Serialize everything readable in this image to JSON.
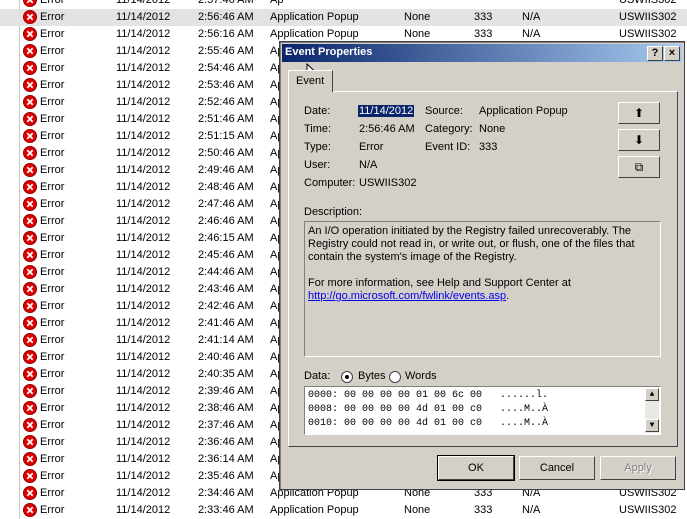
{
  "list": {
    "rows": [
      {
        "type": "Error",
        "date": "11/14/2012",
        "time": "2:57:46 AM",
        "source": "Ap",
        "category": "",
        "event": "",
        "user": "",
        "computer": "USWIIS302"
      },
      {
        "type": "Error",
        "date": "11/14/2012",
        "time": "2:56:46 AM",
        "source": "Application Popup",
        "category": "None",
        "event": "333",
        "user": "N/A",
        "computer": "USWIIS302"
      },
      {
        "type": "Error",
        "date": "11/14/2012",
        "time": "2:56:16 AM",
        "source": "Application Popup",
        "category": "None",
        "event": "333",
        "user": "N/A",
        "computer": "USWIIS302"
      },
      {
        "type": "Error",
        "date": "11/14/2012",
        "time": "2:55:46 AM",
        "source": "Ap",
        "category": "",
        "event": "",
        "user": "",
        "computer": ""
      },
      {
        "type": "Error",
        "date": "11/14/2012",
        "time": "2:54:46 AM",
        "source": "Ap",
        "category": "",
        "event": "",
        "user": "",
        "computer": ""
      },
      {
        "type": "Error",
        "date": "11/14/2012",
        "time": "2:53:46 AM",
        "source": "Ap",
        "category": "",
        "event": "",
        "user": "",
        "computer": ""
      },
      {
        "type": "Error",
        "date": "11/14/2012",
        "time": "2:52:46 AM",
        "source": "Ap",
        "category": "",
        "event": "",
        "user": "",
        "computer": ""
      },
      {
        "type": "Error",
        "date": "11/14/2012",
        "time": "2:51:46 AM",
        "source": "Ap",
        "category": "",
        "event": "",
        "user": "",
        "computer": ""
      },
      {
        "type": "Error",
        "date": "11/14/2012",
        "time": "2:51:15 AM",
        "source": "Ap",
        "category": "",
        "event": "",
        "user": "",
        "computer": ""
      },
      {
        "type": "Error",
        "date": "11/14/2012",
        "time": "2:50:46 AM",
        "source": "Ap",
        "category": "",
        "event": "",
        "user": "",
        "computer": ""
      },
      {
        "type": "Error",
        "date": "11/14/2012",
        "time": "2:49:46 AM",
        "source": "Ap",
        "category": "",
        "event": "",
        "user": "",
        "computer": ""
      },
      {
        "type": "Error",
        "date": "11/14/2012",
        "time": "2:48:46 AM",
        "source": "Ap",
        "category": "",
        "event": "",
        "user": "",
        "computer": ""
      },
      {
        "type": "Error",
        "date": "11/14/2012",
        "time": "2:47:46 AM",
        "source": "Ap",
        "category": "",
        "event": "",
        "user": "",
        "computer": ""
      },
      {
        "type": "Error",
        "date": "11/14/2012",
        "time": "2:46:46 AM",
        "source": "Ap",
        "category": "",
        "event": "",
        "user": "",
        "computer": ""
      },
      {
        "type": "Error",
        "date": "11/14/2012",
        "time": "2:46:15 AM",
        "source": "Ap",
        "category": "",
        "event": "",
        "user": "",
        "computer": ""
      },
      {
        "type": "Error",
        "date": "11/14/2012",
        "time": "2:45:46 AM",
        "source": "Ap",
        "category": "",
        "event": "",
        "user": "",
        "computer": ""
      },
      {
        "type": "Error",
        "date": "11/14/2012",
        "time": "2:44:46 AM",
        "source": "Ap",
        "category": "",
        "event": "",
        "user": "",
        "computer": ""
      },
      {
        "type": "Error",
        "date": "11/14/2012",
        "time": "2:43:46 AM",
        "source": "Ap",
        "category": "",
        "event": "",
        "user": "",
        "computer": ""
      },
      {
        "type": "Error",
        "date": "11/14/2012",
        "time": "2:42:46 AM",
        "source": "Ap",
        "category": "",
        "event": "",
        "user": "",
        "computer": ""
      },
      {
        "type": "Error",
        "date": "11/14/2012",
        "time": "2:41:46 AM",
        "source": "Ap",
        "category": "",
        "event": "",
        "user": "",
        "computer": ""
      },
      {
        "type": "Error",
        "date": "11/14/2012",
        "time": "2:41:14 AM",
        "source": "Ap",
        "category": "",
        "event": "",
        "user": "",
        "computer": ""
      },
      {
        "type": "Error",
        "date": "11/14/2012",
        "time": "2:40:46 AM",
        "source": "Ap",
        "category": "",
        "event": "",
        "user": "",
        "computer": ""
      },
      {
        "type": "Error",
        "date": "11/14/2012",
        "time": "2:40:35 AM",
        "source": "Ap",
        "category": "",
        "event": "",
        "user": "",
        "computer": ""
      },
      {
        "type": "Error",
        "date": "11/14/2012",
        "time": "2:39:46 AM",
        "source": "Ap",
        "category": "",
        "event": "",
        "user": "",
        "computer": ""
      },
      {
        "type": "Error",
        "date": "11/14/2012",
        "time": "2:38:46 AM",
        "source": "Ap",
        "category": "",
        "event": "",
        "user": "",
        "computer": ""
      },
      {
        "type": "Error",
        "date": "11/14/2012",
        "time": "2:37:46 AM",
        "source": "Ap",
        "category": "",
        "event": "",
        "user": "",
        "computer": ""
      },
      {
        "type": "Error",
        "date": "11/14/2012",
        "time": "2:36:46 AM",
        "source": "Ap",
        "category": "",
        "event": "",
        "user": "",
        "computer": ""
      },
      {
        "type": "Error",
        "date": "11/14/2012",
        "time": "2:36:14 AM",
        "source": "Ap",
        "category": "",
        "event": "",
        "user": "",
        "computer": ""
      },
      {
        "type": "Error",
        "date": "11/14/2012",
        "time": "2:35:46 AM",
        "source": "Ap",
        "category": "",
        "event": "",
        "user": "",
        "computer": ""
      },
      {
        "type": "Error",
        "date": "11/14/2012",
        "time": "2:34:46 AM",
        "source": "Application Popup",
        "category": "None",
        "event": "333",
        "user": "N/A",
        "computer": "USWIIS302"
      },
      {
        "type": "Error",
        "date": "11/14/2012",
        "time": "2:33:46 AM",
        "source": "Application Popup",
        "category": "None",
        "event": "333",
        "user": "N/A",
        "computer": "USWIIS302"
      }
    ]
  },
  "dialog": {
    "title": "Event Properties",
    "help_glyph": "?",
    "close_glyph": "×",
    "tab_label": "Event",
    "date_label": "Date:",
    "date_value": "11/14/2012",
    "time_label": "Time:",
    "time_value": "2:56:46 AM",
    "type_label": "Type:",
    "type_value": "Error",
    "user_label": "User:",
    "user_value": "N/A",
    "computer_label": "Computer:",
    "computer_value": "USWIIS302",
    "source_label": "Source:",
    "source_value": "Application Popup",
    "category_label": "Category:",
    "category_value": "None",
    "eventid_label": "Event ID:",
    "eventid_value": "333",
    "description_label": "Description:",
    "description_text": "An I/O operation initiated by the Registry failed unrecoverably. The Registry could not read in, or write out, or flush, one of the files that contain the system's image of the Registry.",
    "more_info_text": "For more information, see Help and Support Center at",
    "link_text": "http://go.microsoft.com/fwlink/events.asp",
    "link_suffix": ".",
    "data_label": "Data:",
    "bytes_label": "Bytes",
    "words_label": "Words",
    "hex_lines": [
      "0000: 00 00 00 00 01 00 6c 00   ......l.",
      "0008: 00 00 00 00 4d 01 00 c0   ....M..À",
      "0010: 00 00 00 00 4d 01 00 c0   ....M..À"
    ],
    "up_glyph": "⬆",
    "down_glyph": "⬇",
    "copy_glyph": "⧉",
    "ok_label": "OK",
    "cancel_label": "Cancel",
    "apply_label": "Apply"
  }
}
